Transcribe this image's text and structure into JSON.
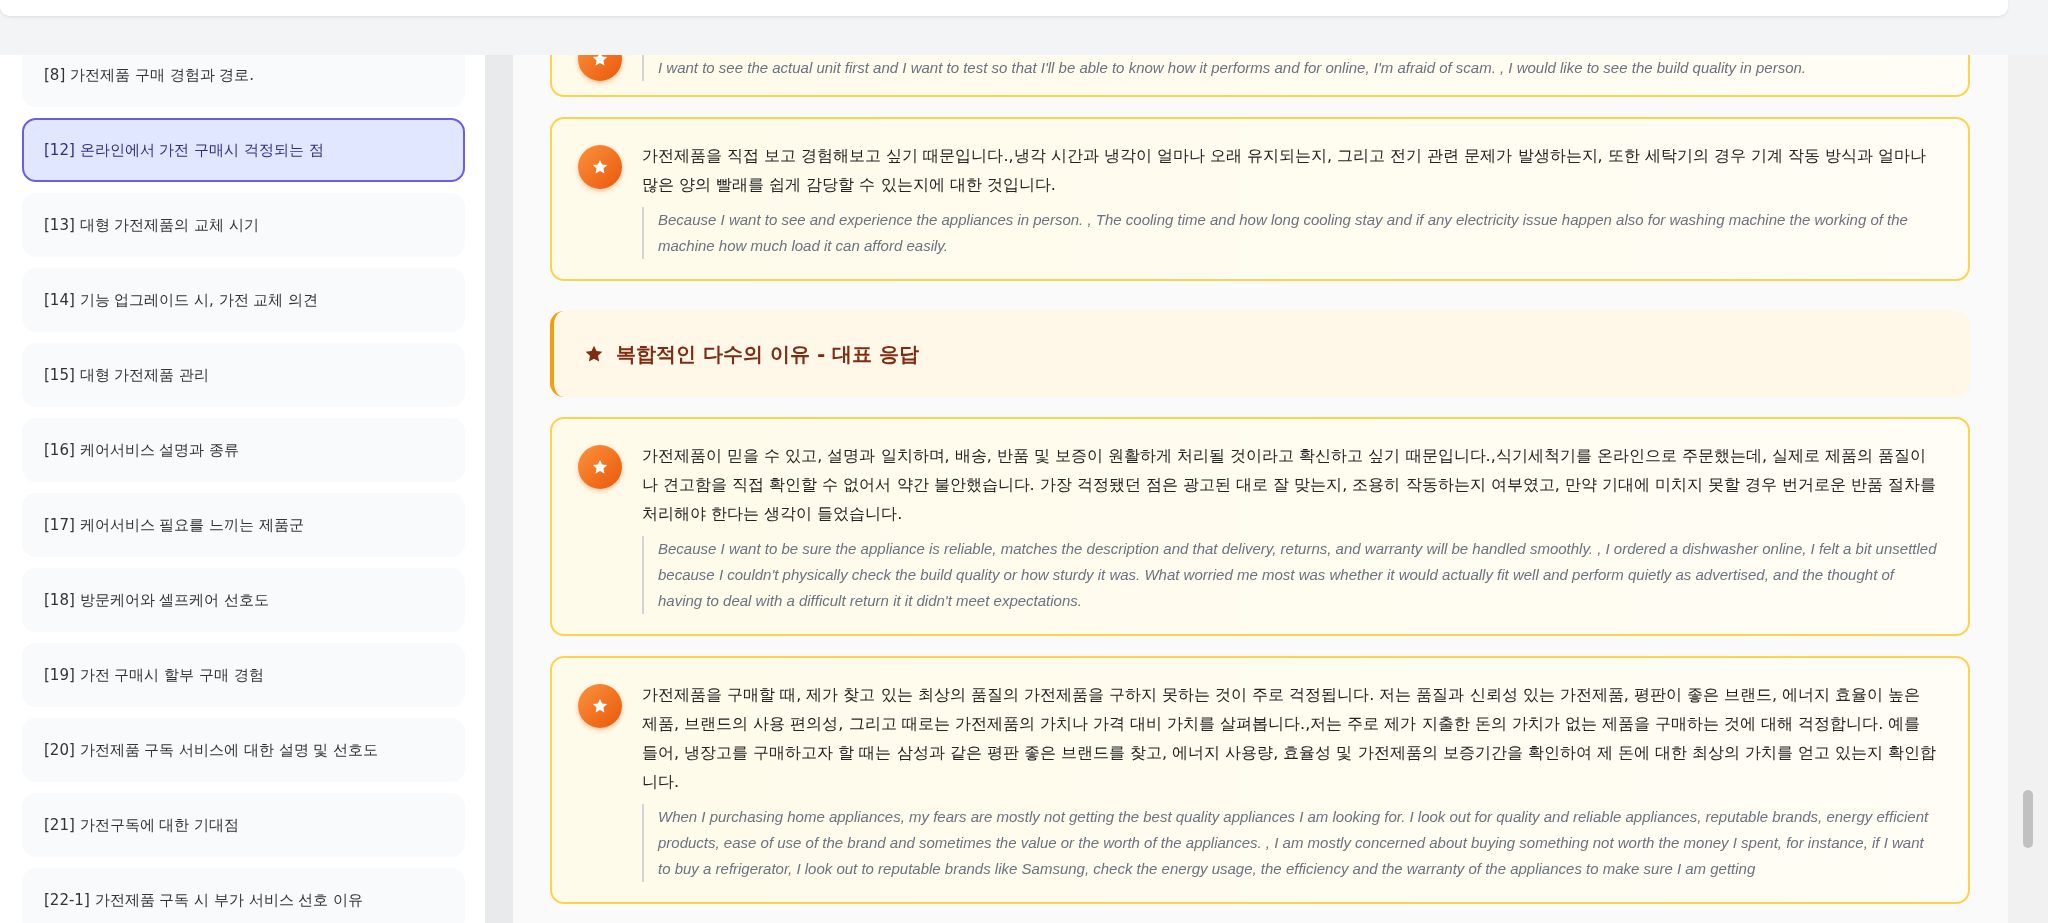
{
  "sidebar": {
    "items": [
      {
        "label": "[8] 가전제품 구매 경험과 경로.",
        "selected": false
      },
      {
        "label": "[12] 온라인에서 가전 구매시 걱정되는 점",
        "selected": true
      },
      {
        "label": "[13] 대형 가전제품의 교체 시기",
        "selected": false
      },
      {
        "label": "[14] 기능 업그레이드 시, 가전 교체 의견",
        "selected": false
      },
      {
        "label": "[15] 대형 가전제품 관리",
        "selected": false
      },
      {
        "label": "[16] 케어서비스 설명과 종류",
        "selected": false
      },
      {
        "label": "[17] 케어서비스 필요를 느끼는 제품군",
        "selected": false
      },
      {
        "label": "[18] 방문케어와 셀프케어 선호도",
        "selected": false
      },
      {
        "label": "[19] 가전 구매시 할부 구매 경험",
        "selected": false
      },
      {
        "label": "[20] 가전제품 구독 서비스에 대한 설명 및 선호도",
        "selected": false
      },
      {
        "label": "[21] 가전구독에 대한 기대점",
        "selected": false
      },
      {
        "label": "[22-1] 가전제품 구독 시 부가 서비스 선호 이유",
        "selected": false
      }
    ]
  },
  "content": {
    "blocks": [
      {
        "kind": "response",
        "english": "I want to see the actual unit first and I want to test so that I'll be able to know how it performs and for online, I'm afraid of scam. , I would like to see the build quality in person."
      },
      {
        "kind": "response",
        "korean": "가전제품을 직접 보고 경험해보고 싶기 때문입니다.,냉각 시간과 냉각이 얼마나 오래 유지되는지, 그리고 전기 관련 문제가 발생하는지, 또한 세탁기의 경우 기계 작동 방식과 얼마나 많은 양의 빨래를 쉽게 감당할 수 있는지에 대한 것입니다.",
        "english": "Because I want to see and experience the appliances in person. , The cooling time and how long cooling stay and if any electricity issue happen also for washing machine the working of the machine how much load it can afford easily."
      },
      {
        "kind": "section",
        "title": "복합적인 다수의 이유 - 대표 응답"
      },
      {
        "kind": "response",
        "korean": "가전제품이 믿을 수 있고, 설명과 일치하며, 배송, 반품 및 보증이 원활하게 처리될 것이라고 확신하고 싶기 때문입니다.,식기세척기를 온라인으로 주문했는데, 실제로 제품의 품질이나 견고함을 직접 확인할 수 없어서 약간 불안했습니다. 가장 걱정됐던 점은 광고된 대로 잘 맞는지, 조용히 작동하는지 여부였고, 만약 기대에 미치지 못할 경우 번거로운 반품 절차를 처리해야 한다는 생각이 들었습니다.",
        "english": "Because I want to be sure the appliance is reliable, matches the description and that delivery, returns, and warranty will be handled smoothly. , I ordered a dishwasher online, I felt a bit unsettled because I couldn't physically check the build quality or how sturdy it was. What worried me most was whether it would actually fit well and perform quietly as advertised, and the thought of having to deal with a difficult return it it didn't meet expectations."
      },
      {
        "kind": "response",
        "korean": "가전제품을 구매할 때, 제가 찾고 있는 최상의 품질의 가전제품을 구하지 못하는 것이 주로 걱정됩니다. 저는 품질과 신뢰성 있는 가전제품, 평판이 좋은 브랜드, 에너지 효율이 높은 제품, 브랜드의 사용 편의성, 그리고 때로는 가전제품의 가치나 가격 대비 가치를 살펴봅니다.,저는 주로 제가 지출한 돈의 가치가 없는 제품을 구매하는 것에 대해 걱정합니다. 예를 들어, 냉장고를 구매하고자 할 때는 삼성과 같은 평판 좋은 브랜드를 찾고, 에너지 사용량, 효율성 및 가전제품의 보증기간을 확인하여 제 돈에 대한 최상의 가치를 얻고 있는지 확인합니다.",
        "english": "When I purchasing home appliances, my fears are mostly not getting the best quality appliances I am looking for. I look out for quality and reliable appliances, reputable brands, energy efficient products, ease of use of the brand and sometimes the value or the worth of the appliances. , I am mostly concerned about buying something not worth the money I spent, for instance, if I want to buy a refrigerator, I look out to reputable brands like Samsung, check the energy usage, the efficiency and the warranty of the appliances to make sure I am getting"
      }
    ]
  }
}
